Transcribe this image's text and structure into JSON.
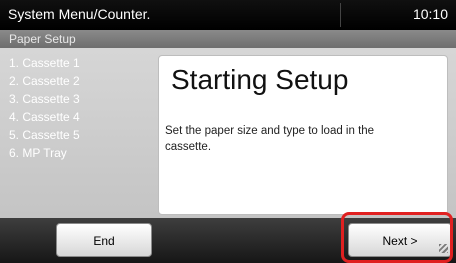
{
  "header": {
    "title": "System Menu/Counter.",
    "time": "10:10"
  },
  "subheader": {
    "title": "Paper Setup"
  },
  "steps": [
    "1. Cassette 1",
    "2. Cassette 2",
    "3. Cassette 3",
    "4. Cassette 4",
    "5. Cassette 5",
    "6. MP Tray"
  ],
  "content": {
    "heading": "Starting Setup",
    "description": "Set the paper size and type to load in the cassette."
  },
  "footer": {
    "end_label": "End",
    "next_label": "Next >"
  },
  "colors": {
    "highlight": "#e02020"
  }
}
